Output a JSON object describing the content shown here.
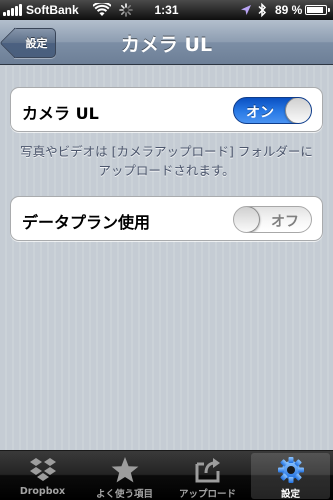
{
  "status_bar": {
    "carrier": "SoftBank",
    "time": "1:31",
    "battery_percent": "89 %",
    "battery_level": 0.89
  },
  "nav": {
    "back_label": "設定",
    "title": "カメラ UL"
  },
  "settings": {
    "camera_ul": {
      "label": "カメラ UL",
      "state_text": "オン",
      "is_on": true
    },
    "camera_ul_note": "写真やビデオは [カメラアップロード] フォルダーにアップロードされます。",
    "data_plan": {
      "label": "データプラン使用",
      "state_text": "オフ",
      "is_on": false
    }
  },
  "tab_bar": {
    "tabs": [
      {
        "label": "Dropbox",
        "icon": "dropbox-icon",
        "selected": false
      },
      {
        "label": "よく使う項目",
        "icon": "star-icon",
        "selected": false
      },
      {
        "label": "アップロード",
        "icon": "upload-icon",
        "selected": false
      },
      {
        "label": "設定",
        "icon": "gear-icon",
        "selected": true
      }
    ]
  },
  "colors": {
    "background": "#c5ccd4",
    "switch_on": "#2a7be6",
    "nav_bar": "#8d9db1",
    "footer_text": "#4c566c"
  }
}
